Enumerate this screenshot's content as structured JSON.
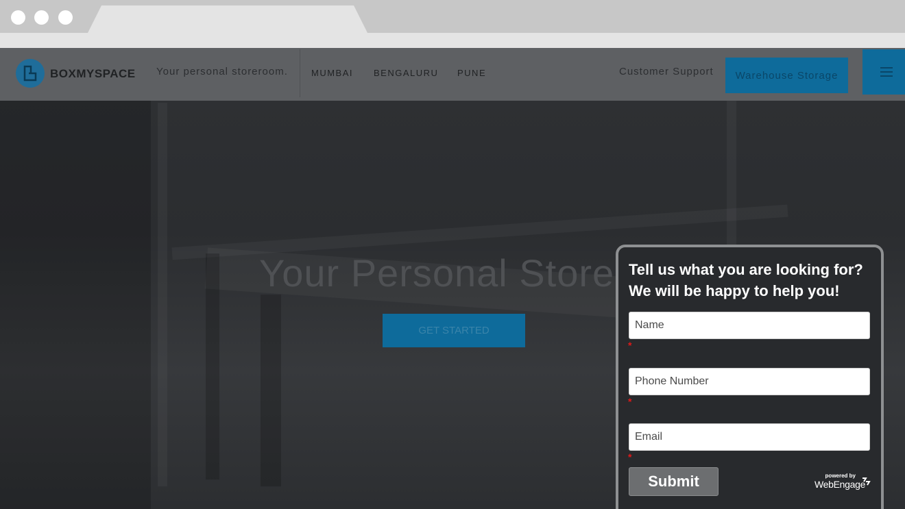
{
  "browser": {
    "tab_title": ""
  },
  "nav": {
    "brand": "BOXMYSPACE",
    "tagline": "Your personal storeroom.",
    "cities": [
      "MUMBAI",
      "BENGALURU",
      "PUNE"
    ],
    "support_label": "Customer Support",
    "warehouse_label": "Warehouse Storage",
    "menu_icon": "hamburger-icon"
  },
  "hero": {
    "title": "Your Personal Storero",
    "cta_label": "GET STARTED"
  },
  "popup": {
    "title_line1": "Tell us what you are looking for?",
    "title_line2": "We will be happy to help you!",
    "fields": {
      "name_placeholder": "Name",
      "phone_placeholder": "Phone Number",
      "email_placeholder": "Email"
    },
    "required_marker": "*",
    "submit_label": "Submit",
    "powered_by": "powered by",
    "powered_brand": "WebEngage"
  },
  "colors": {
    "accent": "#0e6b9b",
    "overlay_nav": "#5e6063",
    "popup_bg": "#282a2d",
    "required": "#e01919"
  }
}
